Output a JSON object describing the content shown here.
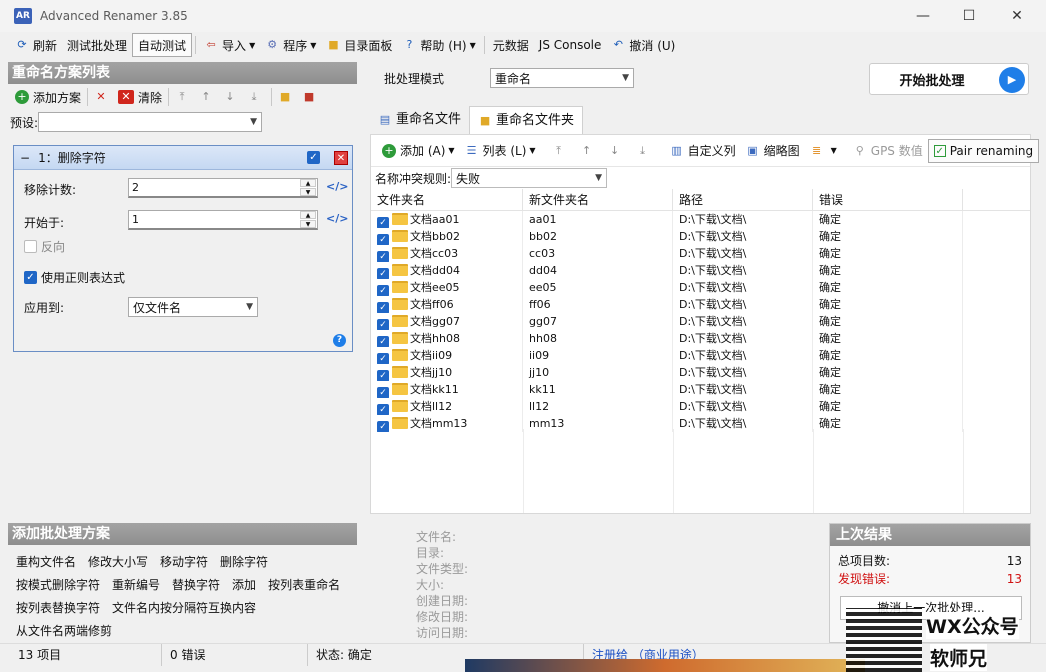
{
  "window": {
    "title": "Advanced Renamer 3.85",
    "icon": "app-icon",
    "controls": {
      "min": "—",
      "max": "☐",
      "close": "✕"
    }
  },
  "toolbar": {
    "refresh": "刷新",
    "test_batch": "测试批处理",
    "auto_test": "自动测试",
    "import": "导入",
    "program": "程序",
    "dir_panel": "目录面板",
    "help": "帮助 (H)",
    "metadata": "元数据",
    "js_console": "JS Console",
    "undo": "撤消 (U)"
  },
  "left_panel": {
    "title": "重命名方案列表",
    "add_method": "添加方案",
    "clear": "清除",
    "preset_label": "预设:",
    "preset_value": "",
    "method": {
      "header": "1：删除字符",
      "remove_count_label": "移除计数:",
      "remove_count": "2",
      "start_at_label": "开始于:",
      "start_at": "1",
      "reverse_label": "反向",
      "use_regex_label": "使用正则表达式",
      "apply_to_label": "应用到:",
      "apply_to_value": "仅文件名"
    }
  },
  "add_panel": {
    "title": "添加批处理方案",
    "items": [
      "重构文件名",
      "修改大小写",
      "移动字符",
      "删除字符",
      "按模式删除字符",
      "重新编号",
      "替换字符",
      "添加",
      "按列表重命名",
      "按列表替换字符",
      "文件名内按分隔符互换内容",
      "从文件名两端修剪"
    ]
  },
  "batch": {
    "mode_label": "批处理模式",
    "mode_value": "重命名",
    "start_button": "开始批处理"
  },
  "tabs": {
    "files": "重命名文件",
    "folders": "重命名文件夹"
  },
  "grid_toolbar": {
    "add": "添加 (A)",
    "list": "列表 (L)",
    "custom_cols": "自定义列",
    "thumbnails": "缩略图",
    "gps": "GPS 数值",
    "pair": "Pair renaming"
  },
  "conflict": {
    "label": "名称冲突规则:",
    "value": "失败"
  },
  "columns": {
    "folder": "文件夹名",
    "new_folder": "新文件夹名",
    "path": "路径",
    "error": "错误"
  },
  "rows": [
    {
      "name": "文档aa01",
      "new": "aa01",
      "path": "D:\\下载\\文档\\",
      "err": "确定"
    },
    {
      "name": "文档bb02",
      "new": "bb02",
      "path": "D:\\下载\\文档\\",
      "err": "确定"
    },
    {
      "name": "文档cc03",
      "new": "cc03",
      "path": "D:\\下载\\文档\\",
      "err": "确定"
    },
    {
      "name": "文档dd04",
      "new": "dd04",
      "path": "D:\\下载\\文档\\",
      "err": "确定"
    },
    {
      "name": "文档ee05",
      "new": "ee05",
      "path": "D:\\下载\\文档\\",
      "err": "确定"
    },
    {
      "name": "文档ff06",
      "new": "ff06",
      "path": "D:\\下载\\文档\\",
      "err": "确定"
    },
    {
      "name": "文档gg07",
      "new": "gg07",
      "path": "D:\\下载\\文档\\",
      "err": "确定"
    },
    {
      "name": "文档hh08",
      "new": "hh08",
      "path": "D:\\下载\\文档\\",
      "err": "确定"
    },
    {
      "name": "文档ii09",
      "new": "ii09",
      "path": "D:\\下载\\文档\\",
      "err": "确定"
    },
    {
      "name": "文档jj10",
      "new": "jj10",
      "path": "D:\\下载\\文档\\",
      "err": "确定"
    },
    {
      "name": "文档kk11",
      "new": "kk11",
      "path": "D:\\下载\\文档\\",
      "err": "确定"
    },
    {
      "name": "文档ll12",
      "new": "ll12",
      "path": "D:\\下载\\文档\\",
      "err": "确定"
    },
    {
      "name": "文档mm13",
      "new": "mm13",
      "path": "D:\\下载\\文档\\",
      "err": "确定"
    }
  ],
  "file_info": [
    "文件名:",
    "目录:",
    "文件类型:",
    "大小:",
    "创建日期:",
    "修改日期:",
    "访问日期:"
  ],
  "last_result": {
    "title": "上次结果",
    "total_label": "总项目数:",
    "total": "13",
    "errors_label": "发现错误:",
    "errors": "13",
    "undo_button": "撤消上一次批处理..."
  },
  "status": {
    "items": "13 项目",
    "errors": "0 错误",
    "state": "状态: 确定",
    "register": "注册给 （商业用途）"
  },
  "watermark": {
    "line1": "WX公众号",
    "line2": "软师兄"
  },
  "colors": {
    "accent": "#1f66c6",
    "error_text": "#d01010",
    "link": "#1a4fc4"
  }
}
